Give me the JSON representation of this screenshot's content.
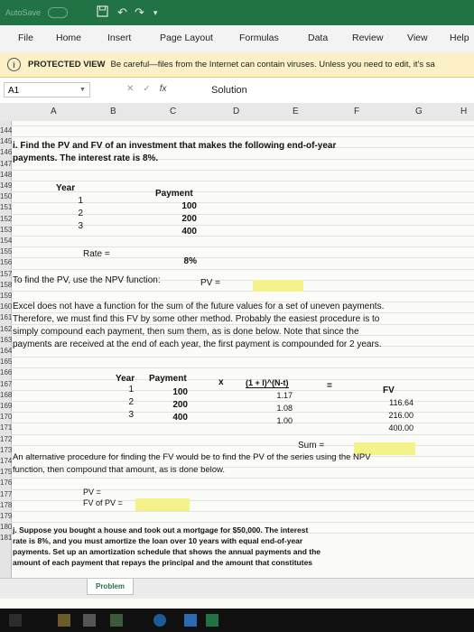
{
  "titlebar": {
    "autosave": "AutoSave",
    "save_icon": "save-icon",
    "undo_icon": "undo-icon",
    "redo_icon": "redo-icon"
  },
  "ribbon": {
    "tabs": [
      "File",
      "Home",
      "Insert",
      "Page Layout",
      "Formulas",
      "Data",
      "Review",
      "View",
      "Help"
    ]
  },
  "protected_view": {
    "label": "PROTECTED VIEW",
    "message": "Be careful—files from the Internet can contain viruses. Unless you need to edit, it's sa"
  },
  "formula_bar": {
    "name_box": "A1",
    "fx": "fx",
    "value": "Solution"
  },
  "columns": [
    "A",
    "B",
    "C",
    "D",
    "E",
    "F",
    "G",
    "H"
  ],
  "rows": [
    "144",
    "145",
    "146",
    "147",
    "148",
    "149",
    "150",
    "151",
    "152",
    "153",
    "154",
    "155",
    "156",
    "157",
    "158",
    "159",
    "160",
    "161",
    "162",
    "163",
    "164",
    "165",
    "166",
    "167",
    "168",
    "169",
    "170",
    "171",
    "172",
    "173",
    "174",
    "175",
    "176",
    "177",
    "178",
    "179",
    "180",
    "181"
  ],
  "sheet": {
    "q_i_line1": "i.  Find the PV and FV of an investment that makes the following end-of-year",
    "q_i_line2": "payments.  The interest rate is 8%.",
    "year_header": "Year",
    "payment_header": "Payment",
    "years": [
      "1",
      "2",
      "3"
    ],
    "payments": [
      "100",
      "200",
      "400"
    ],
    "rate_label": "Rate  =",
    "rate_value": "8%",
    "npv_text": "To find the PV, use the NPV function:",
    "pv_eq": "PV  =",
    "para1": "Excel does not have a function for the sum of the future values for a set of uneven payments.",
    "para2": "Therefore, we must find this FV by some other method.  Probably the easiest procedure is to",
    "para3": "simply compound each payment, then sum them, as is done below.  Note that since the",
    "para4": "payments are received at the end of each year, the first payment is compounded for 2 years.",
    "t2_year": "Year",
    "t2_payment": "Payment",
    "t2_x": "x",
    "t2_factor": "(1 + I)^(N-t)",
    "t2_eq": "=",
    "t2_fv": "FV",
    "t2_years": [
      "1",
      "2",
      "3"
    ],
    "t2_payments": [
      "100",
      "200",
      "400"
    ],
    "t2_factors": [
      "1.17",
      "1.08",
      "1.00"
    ],
    "t2_fvs": [
      "116.64",
      "216.00",
      "400.00"
    ],
    "sum_label": "Sum  =",
    "alt1": "An alternative procedure for finding the FV would be to find the PV of the series using the NPV",
    "alt2": "function, then compound that amount, as is done below.",
    "pv_eq2": "PV =",
    "fv_of_pv": "FV of PV  =",
    "q_j1": "j.  Suppose you bought a house and took out a mortgage for $50,000.  The interest",
    "q_j2": "rate is 8%, and  you must amortize the loan over 10 years with equal end-of-year",
    "q_j3": "payments.  Set up an amortization schedule that shows the annual payments and the",
    "q_j4": "amount of each payment that repays the  principal and the amount that constitutes",
    "sheet_tab": "Problem"
  },
  "colors": {
    "excel_green": "#217346",
    "warning_bar": "#fcf1c6",
    "highlight": "#f4f28a"
  }
}
